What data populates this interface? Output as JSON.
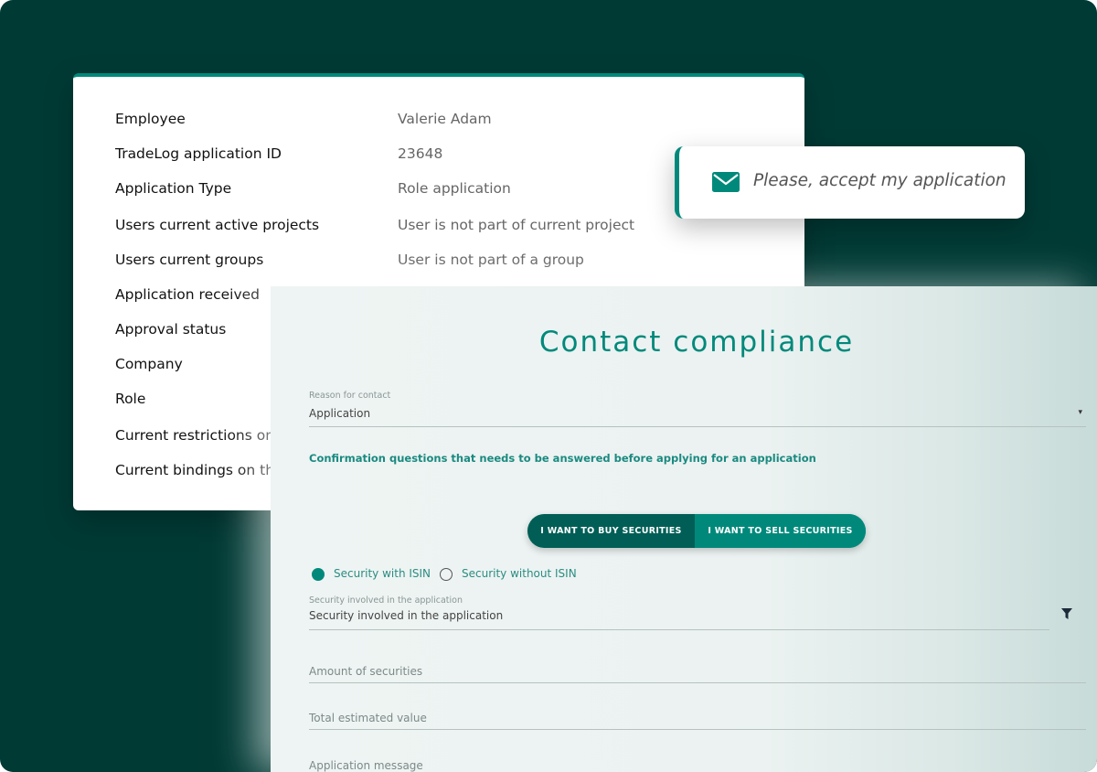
{
  "details": {
    "rows": [
      {
        "label": "Employee",
        "value": "Valerie Adam"
      },
      {
        "label": "TradeLog application ID",
        "value": "23648"
      },
      {
        "label": "Application Type",
        "value": "Role application"
      },
      {
        "label": "Users current active projects",
        "value": "User is not part of current project"
      },
      {
        "label": "Users current groups",
        "value": "User is not part of a group"
      },
      {
        "label": "Application received",
        "value": ""
      },
      {
        "label": "Approval status",
        "value": ""
      },
      {
        "label": "Company",
        "value": ""
      },
      {
        "label": "Role",
        "value": ""
      },
      {
        "label": "Current restrictions on",
        "value": ""
      },
      {
        "label": "Current bindings on thi",
        "value": ""
      }
    ]
  },
  "message": {
    "icon": "envelope-icon",
    "text": "Please, accept my application"
  },
  "compliance": {
    "title": "Contact compliance",
    "reason": {
      "label": "Reason for contact",
      "value": "Application",
      "arrow": "▾"
    },
    "confirmation_text": "Confirmation questions that needs to be answered before applying for an application",
    "toggle": {
      "buy_label": "I WANT TO BUY SECURITIES",
      "sell_label": "I WANT TO SELL SECURITIES",
      "selected": "buy"
    },
    "radio": {
      "with_isin": "Security with ISIN",
      "without_isin": "Security without ISIN",
      "selected": "with_isin"
    },
    "security": {
      "label": "Security involved in the application",
      "value": "Security involved in the application",
      "icon": "filter-icon"
    },
    "amount_placeholder": "Amount of securities",
    "total_placeholder": "Total estimated value",
    "message_placeholder": "Application message"
  },
  "colors": {
    "background": "#003a35",
    "accent": "#00897b",
    "accent_dark": "#005e56"
  }
}
